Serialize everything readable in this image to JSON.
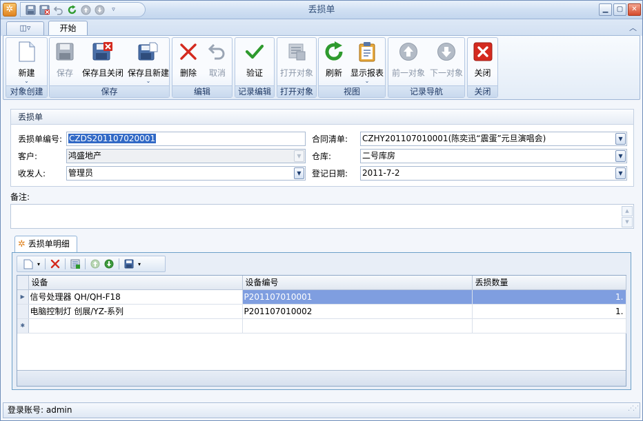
{
  "window": {
    "title": "丢损单",
    "quick_access_icons": [
      "app-icon",
      "save-icon",
      "save-close-icon",
      "undo-icon",
      "refresh-icon",
      "previous-icon",
      "next-icon",
      "customize-icon"
    ],
    "controls": [
      "minimize",
      "maximize",
      "close"
    ]
  },
  "tabs": {
    "app_menu_icon": "menu-icon",
    "active": "开始"
  },
  "ribbon": {
    "groups": [
      {
        "caption": "对象创建",
        "buttons": [
          {
            "label": "新建",
            "icon": "new-icon",
            "enabled": true
          }
        ]
      },
      {
        "caption": "保存",
        "buttons": [
          {
            "label": "保存",
            "icon": "save-icon",
            "enabled": false
          },
          {
            "label": "保存且关闭",
            "icon": "save-close-icon",
            "enabled": true
          },
          {
            "label": "保存且新建",
            "icon": "save-new-icon",
            "enabled": true,
            "dropdown": true
          }
        ]
      },
      {
        "caption": "编辑",
        "buttons": [
          {
            "label": "删除",
            "icon": "delete-icon",
            "enabled": true
          },
          {
            "label": "取消",
            "icon": "undo-icon",
            "enabled": false
          }
        ]
      },
      {
        "caption": "记录编辑",
        "buttons": [
          {
            "label": "验证",
            "icon": "check-icon",
            "enabled": true
          }
        ]
      },
      {
        "caption": "打开对象",
        "buttons": [
          {
            "label": "打开对象",
            "icon": "open-object-icon",
            "enabled": false
          }
        ]
      },
      {
        "caption": "视图",
        "buttons": [
          {
            "label": "刷新",
            "icon": "refresh-icon",
            "enabled": true
          },
          {
            "label": "显示报表",
            "icon": "report-icon",
            "enabled": true,
            "dropdown": true
          }
        ]
      },
      {
        "caption": "记录导航",
        "buttons": [
          {
            "label": "前一对象",
            "icon": "up-arrow-icon",
            "enabled": false
          },
          {
            "label": "下一对象",
            "icon": "down-arrow-icon",
            "enabled": false
          }
        ]
      },
      {
        "caption": "关闭",
        "buttons": [
          {
            "label": "关闭",
            "icon": "close-icon",
            "enabled": true
          }
        ]
      }
    ]
  },
  "form": {
    "header": "丢损单",
    "fields": {
      "number_label": "丢损单编号:",
      "number_value": "CZDS201107020001",
      "contract_label": "合同清单:",
      "contract_value": "CZHY201107010001(陈奕迅“震蛋”元旦演唱会)",
      "customer_label": "客户:",
      "customer_value": "鸿盛地产",
      "warehouse_label": "仓库:",
      "warehouse_value": "二号库房",
      "handler_label": "收发人:",
      "handler_value": "管理员",
      "date_label": "登记日期:",
      "date_value": "2011-7-2"
    },
    "remark_label": "备注:",
    "remark_value": ""
  },
  "detail": {
    "tab_label": "丢损单明细",
    "columns": [
      "设备",
      "设备编号",
      "丢损数量"
    ],
    "rows": [
      {
        "equipment": "信号处理器 QH/QH-F18",
        "code": "P201107010001",
        "qty": "1."
      },
      {
        "equipment": "电脑控制灯 创展/YZ-系列",
        "code": "P201107010002",
        "qty": "1."
      }
    ]
  },
  "status": {
    "text": "登录账号: admin"
  },
  "colors": {
    "accent": "#3169c6",
    "selected_row": "#7f9ee0",
    "delete_red": "#d42a1f",
    "check_green": "#2e9a2e"
  }
}
